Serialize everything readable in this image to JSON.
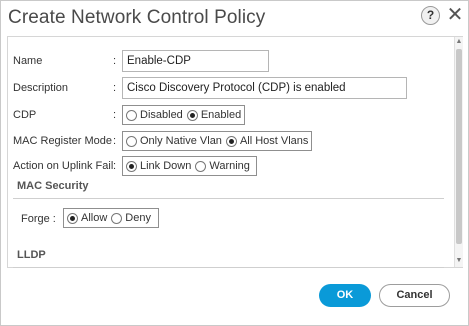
{
  "window": {
    "title": "Create Network Control Policy",
    "help_label": "?",
    "close_label": "✕"
  },
  "form": {
    "name": {
      "label": "Name",
      "value": "Enable-CDP"
    },
    "description": {
      "label": "Description",
      "value": "Cisco Discovery Protocol (CDP) is enabled"
    },
    "cdp": {
      "label": "CDP",
      "options": [
        "Disabled",
        "Enabled"
      ],
      "selected": "Enabled"
    },
    "mac_register_mode": {
      "label": "MAC Register Mode",
      "options": [
        "Only Native Vlan",
        "All Host Vlans"
      ],
      "selected": "All Host Vlans"
    },
    "uplink_fail": {
      "label": "Action on Uplink Fail",
      "options": [
        "Link Down",
        "Warning"
      ],
      "selected": "Link Down"
    },
    "colon": ":"
  },
  "mac_security": {
    "heading": "MAC Security",
    "forge": {
      "label": "Forge :",
      "options": [
        "Allow",
        "Deny"
      ],
      "selected": "Allow"
    }
  },
  "lldp": {
    "heading": "LLDP"
  },
  "footer": {
    "ok_label": "OK",
    "cancel_label": "Cancel"
  },
  "colors": {
    "primary_button": "#0a9ad8"
  }
}
